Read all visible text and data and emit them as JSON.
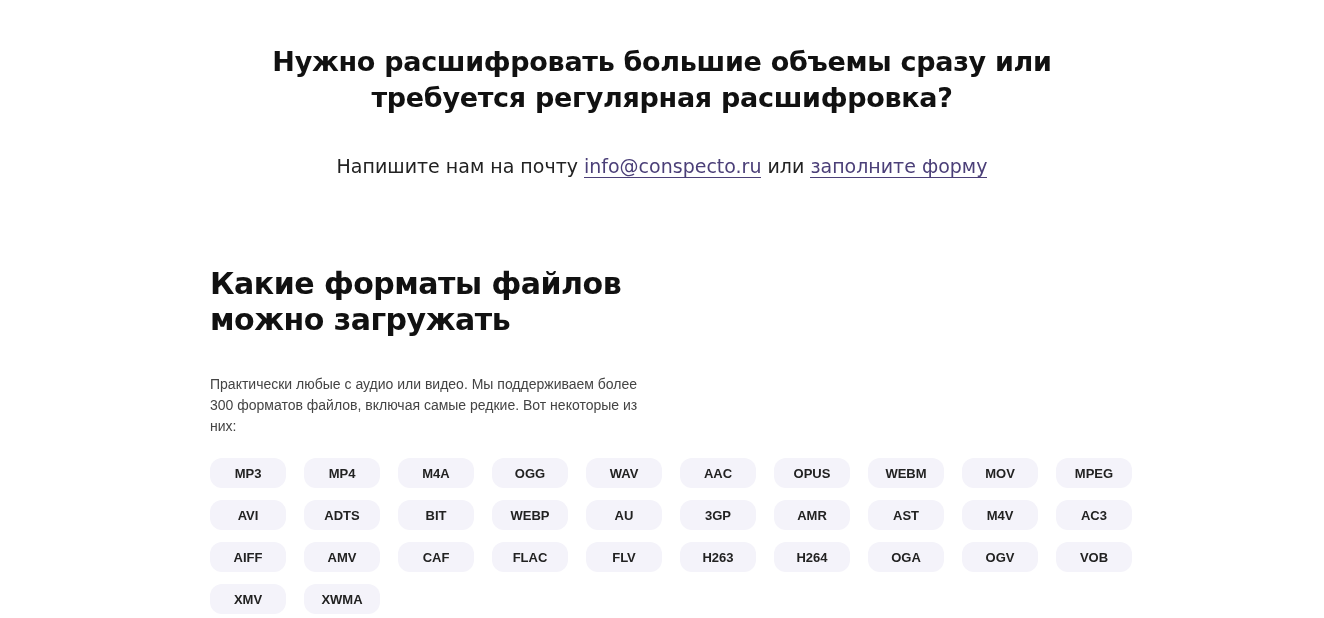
{
  "cta": {
    "title_lines": [
      "Нужно расшифровать большие объемы сразу или",
      "требуется регулярная расшифровка?"
    ],
    "contact": {
      "text_before": "Напишите нам на почту",
      "email_link": "info@conspecto.ru",
      "text_between": "или",
      "form_link": "заполните форму"
    }
  },
  "formats": {
    "title_lines": [
      "Какие форматы файлов",
      "можно загружать"
    ],
    "description": "Практически любые с аудио или видео. Мы поддерживаем более 300 форматов файлов, включая самые редкие. Вот некоторые из них:",
    "tags": [
      "MP3",
      "MP4",
      "M4A",
      "OGG",
      "WAV",
      "AAC",
      "OPUS",
      "WEBM",
      "MOV",
      "MPEG",
      "AVI",
      "ADTS",
      "BIT",
      "WEBP",
      "AU",
      "3GP",
      "AMR",
      "AST",
      "M4V",
      "AC3",
      "AIFF",
      "AMV",
      "CAF",
      "FLAC",
      "FLV",
      "H263",
      "H264",
      "OGA",
      "OGV",
      "VOB",
      "XMV",
      "XWMA"
    ]
  }
}
